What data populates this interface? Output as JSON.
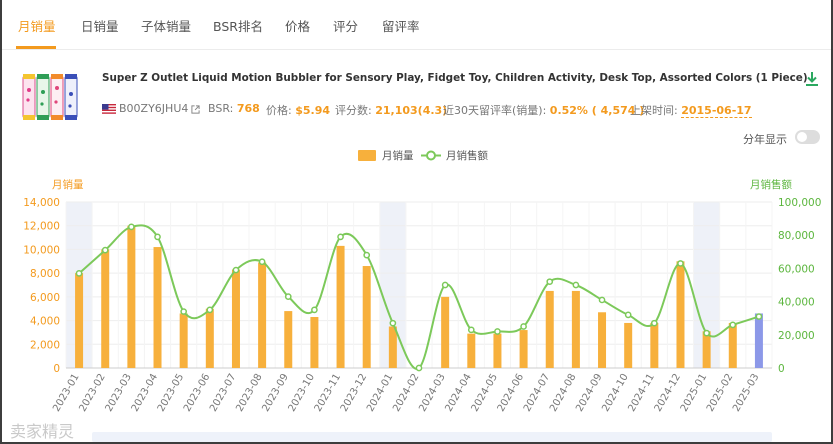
{
  "tabs": [
    {
      "label": "月销量",
      "active": true
    },
    {
      "label": "日销量",
      "active": false
    },
    {
      "label": "子体销量",
      "active": false
    },
    {
      "label": "BSR排名",
      "active": false
    },
    {
      "label": "价格",
      "active": false
    },
    {
      "label": "评分",
      "active": false
    },
    {
      "label": "留评率",
      "active": false
    }
  ],
  "product": {
    "title": "Super Z Outlet Liquid Motion Bubbler for Sensory Play, Fidget Toy, Children Activity, Desk Top, Assorted Colors (1 Piece)",
    "asin": "B00ZY6JHU4",
    "bsr_label": "BSR:",
    "bsr_value": "768",
    "price_label": "价格:",
    "price_value": "$5.94",
    "reviews_label": "评分数:",
    "reviews_value": "21,103(4.3)",
    "review_rate_label": "近30天留评率(销量):",
    "review_rate_value": "0.52% ( 4,574 )",
    "listed_label": "上架时间:",
    "listed_value": "2015-06-17"
  },
  "controls": {
    "year_toggle_label": "分年显示",
    "year_toggle_on": false
  },
  "watermark": "卖家精灵",
  "colors": {
    "accent": "#f39a1e",
    "bar": "#f7b03c",
    "bar_highlight": "#8c98e8",
    "line": "#7cc95a",
    "shade": "#eef1f8"
  },
  "chart_data": {
    "type": "bar",
    "legend": [
      "月销量",
      "月销售额"
    ],
    "legend_position": "top-center",
    "y_left_label": "月销量",
    "y_right_label": "月销售额",
    "y_left_range": [
      0,
      14000
    ],
    "y_left_ticks": [
      "0",
      "2,000",
      "4,000",
      "6,000",
      "8,000",
      "10,000",
      "12,000",
      "14,000"
    ],
    "y_right_range": [
      0,
      100000
    ],
    "y_right_ticks": [
      "0",
      "20,000",
      "40,000",
      "60,000",
      "80,000",
      "100,000"
    ],
    "categories": [
      "2023-01",
      "2023-02",
      "2023-03",
      "2023-04",
      "2023-05",
      "2023-06",
      "2023-07",
      "2023-08",
      "2023-09",
      "2023-10",
      "2023-11",
      "2023-12",
      "2024-01",
      "2024-02",
      "2024-03",
      "2024-04",
      "2024-05",
      "2024-06",
      "2024-07",
      "2024-08",
      "2024-09",
      "2024-10",
      "2024-11",
      "2024-12",
      "2025-01",
      "2025-02",
      "2025-03"
    ],
    "series": [
      {
        "name": "月销量",
        "type": "bar",
        "axis": "left",
        "values": [
          8000,
          10000,
          12000,
          10200,
          4600,
          5000,
          8300,
          8900,
          4800,
          4300,
          10300,
          8600,
          3500,
          0,
          6000,
          2900,
          2900,
          3200,
          6500,
          6500,
          4700,
          3800,
          3800,
          9000,
          3100,
          3800,
          4600
        ]
      },
      {
        "name": "月销售额",
        "type": "line",
        "axis": "right",
        "values": [
          57000,
          71000,
          85000,
          79000,
          34000,
          35000,
          59000,
          64000,
          43000,
          35000,
          79000,
          68000,
          27000,
          0,
          50000,
          23000,
          22000,
          25000,
          52000,
          50000,
          41000,
          32000,
          27000,
          63000,
          21000,
          26000,
          31000
        ]
      }
    ],
    "highlighted_bar_index": 26,
    "shaded_categories": [
      "2023-01",
      "2024-01",
      "2025-01"
    ],
    "grid": true
  }
}
